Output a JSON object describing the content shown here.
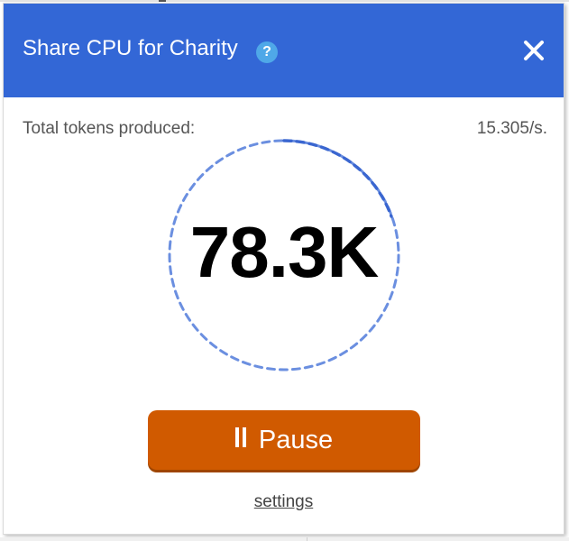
{
  "header": {
    "title": "Share CPU for Charity",
    "help_icon": "help-icon",
    "close_icon": "close-icon",
    "help_glyph": "?",
    "background_color": "#3367d6"
  },
  "stats": {
    "tokens_label": "Total tokens produced:",
    "rate": "15.305/s.",
    "count": "78.3K"
  },
  "controls": {
    "pause_label": "Pause",
    "pause_icon": "pause-icon",
    "pause_color": "#d05a00",
    "settings_label": "settings"
  }
}
